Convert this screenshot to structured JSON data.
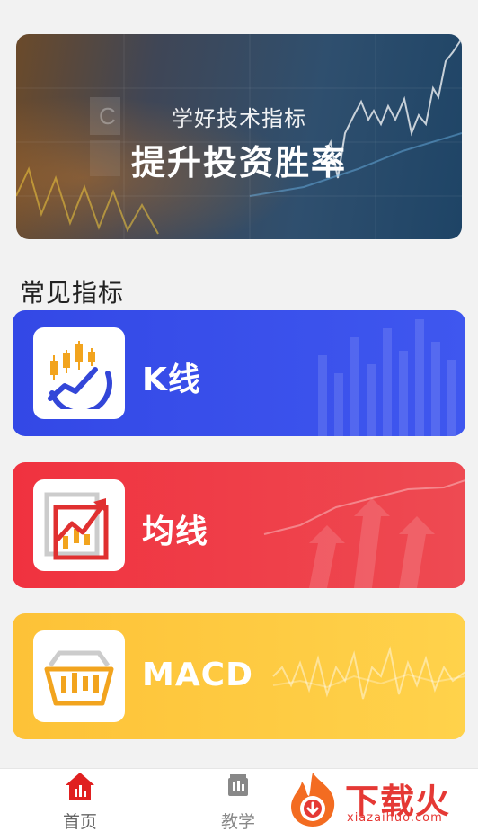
{
  "banner": {
    "subtitle": "学好技术指标",
    "title": "提升投资胜率"
  },
  "section": {
    "title": "常见指标"
  },
  "cards": [
    {
      "label": "K线",
      "icon": "candlestick-icon",
      "color": "#3a4fe9"
    },
    {
      "label": "均线",
      "icon": "moving-average-icon",
      "color": "#ef3a45"
    },
    {
      "label": "MACD",
      "icon": "macd-basket-icon",
      "color": "#fec63c"
    }
  ],
  "tabbar": {
    "home_label": "首页",
    "home_icon": "home-icon",
    "teach_label": "教学",
    "teach_icon": "teaching-icon",
    "active_color": "#e02020"
  },
  "watermark": {
    "text": "下载火",
    "domain": "xiazaihuo.com"
  }
}
